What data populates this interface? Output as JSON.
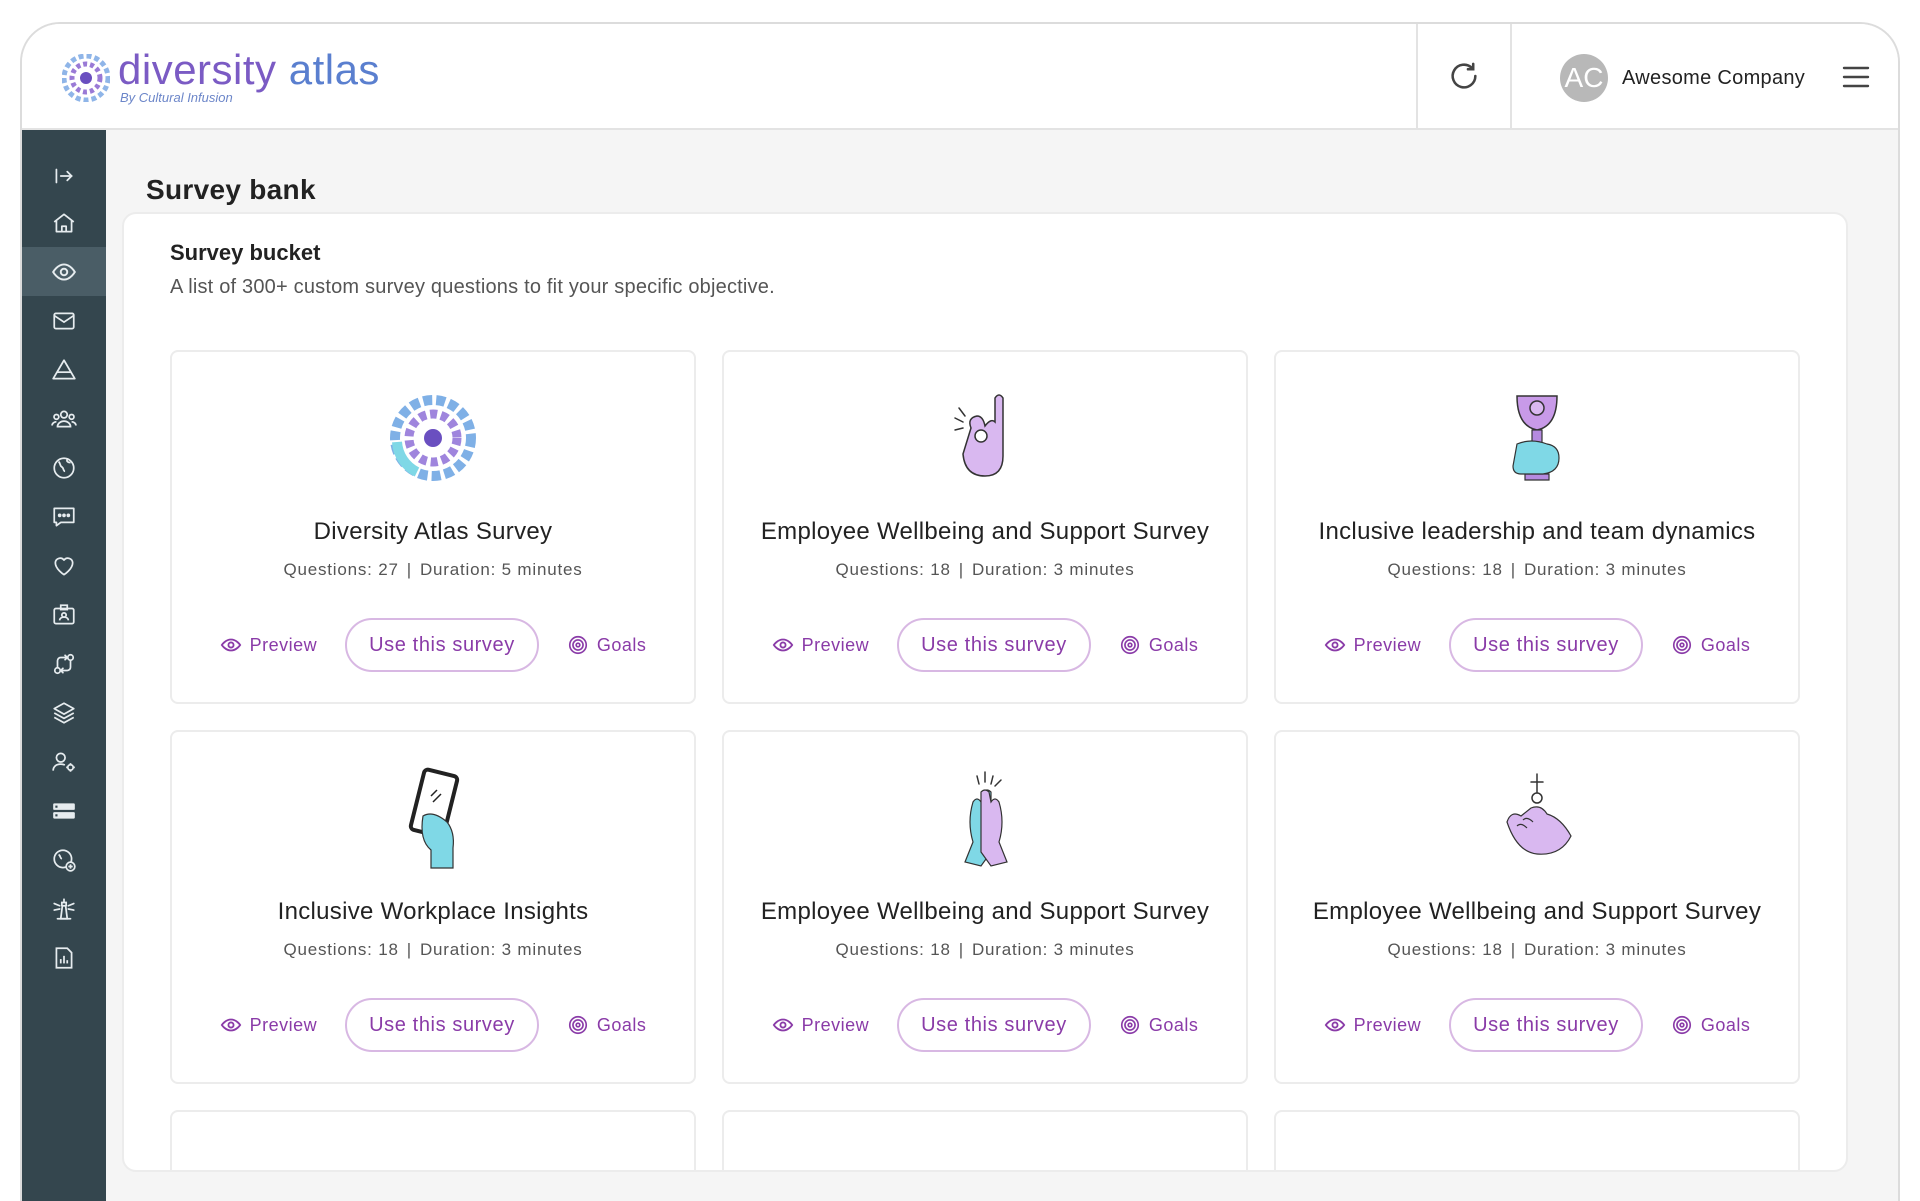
{
  "brand": {
    "name_part1": "diversity",
    "name_part2": " atlas",
    "tagline": "By Cultural Infusion"
  },
  "header": {
    "avatar_initials": "AC",
    "account_name": "Awesome Company",
    "refresh_icon": "refresh-icon",
    "menu_icon": "hamburger-menu-icon"
  },
  "sidebar": {
    "expand_icon": "expand-sidebar-icon",
    "items": [
      {
        "icon": "home-icon"
      },
      {
        "icon": "eye-icon",
        "active": true
      },
      {
        "icon": "mail-icon"
      },
      {
        "icon": "triangle-icon"
      },
      {
        "icon": "users-group-icon"
      },
      {
        "icon": "globe-icon"
      },
      {
        "icon": "chat-icon"
      },
      {
        "icon": "heart-icon"
      },
      {
        "icon": "id-badge-icon"
      },
      {
        "icon": "workflow-icon"
      },
      {
        "icon": "layers-icon"
      },
      {
        "icon": "user-settings-icon"
      },
      {
        "icon": "storage-icon"
      },
      {
        "icon": "globe-add-icon"
      },
      {
        "icon": "lighthouse-icon"
      },
      {
        "icon": "report-icon"
      }
    ]
  },
  "page": {
    "title": "Survey bank",
    "bucket_title": "Survey bucket",
    "bucket_subtitle": "A list of 300+ custom survey questions to fit your specific objective."
  },
  "labels": {
    "questions_prefix": "Questions:",
    "duration_prefix": "Duration:",
    "preview": "Preview",
    "use_survey": "Use this survey",
    "goals": "Goals"
  },
  "surveys": [
    {
      "title": "Diversity Atlas Survey",
      "questions": "Questions: 27",
      "duration": "Duration: 5 minutes",
      "illustration": "diversity-atlas-logo-icon"
    },
    {
      "title": "Employee Wellbeing and Support Survey",
      "questions": "Questions: 18",
      "duration": "Duration: 3 minutes",
      "illustration": "ok-hand-icon"
    },
    {
      "title": "Inclusive leadership and team dynamics",
      "questions": "Questions: 18",
      "duration": "Duration: 3 minutes",
      "illustration": "trophy-hand-icon"
    },
    {
      "title": "Inclusive Workplace Insights",
      "questions": "Questions: 18",
      "duration": "Duration: 3 minutes",
      "illustration": "phone-hand-icon"
    },
    {
      "title": "Employee Wellbeing and Support Survey",
      "questions": "Questions: 18",
      "duration": "Duration: 3 minutes",
      "illustration": "high-five-icon"
    },
    {
      "title": "Employee Wellbeing and Support Survey",
      "questions": "Questions: 18",
      "duration": "Duration: 3 minutes",
      "illustration": "hand-holding-icon"
    }
  ],
  "colors": {
    "accent": "#8a3ba8",
    "accent_border": "#d8b8e3",
    "sidebar_bg": "#34464e",
    "sidebar_active": "#4a5d66",
    "illus_purple": "#d9b8f0",
    "illus_cyan": "#7fd8e6"
  }
}
